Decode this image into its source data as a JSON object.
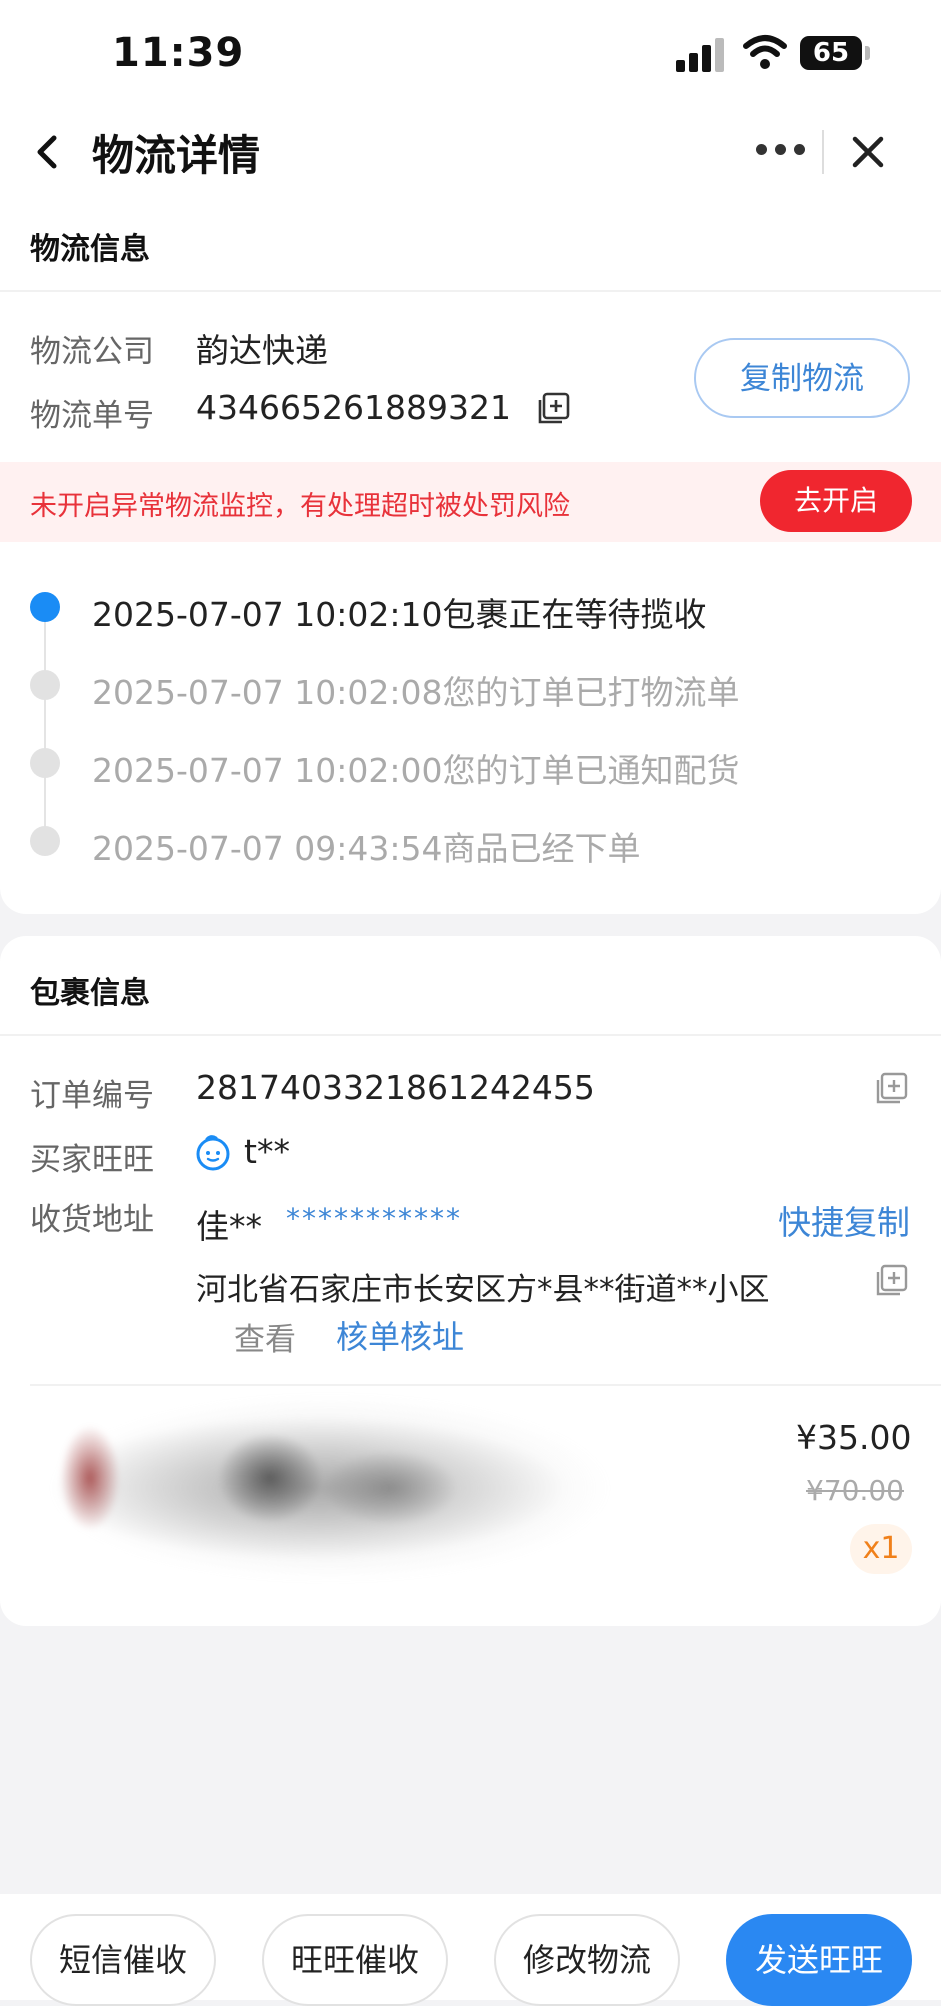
{
  "status_bar": {
    "time": "11:39",
    "battery": "65"
  },
  "nav": {
    "title": "物流详情"
  },
  "logistics": {
    "section_title": "物流信息",
    "company_label": "物流公司",
    "company_value": "韵达快递",
    "tracking_label": "物流单号",
    "tracking_value": "434665261889321",
    "copy_button": "复制物流",
    "alert_text": "未开启异常物流监控，有处理超时被处罚风险",
    "alert_button": "去开启",
    "timeline": [
      {
        "text": "2025-07-07 10:02:10包裹正在等待揽收"
      },
      {
        "text": "2025-07-07 10:02:08您的订单已打物流单"
      },
      {
        "text": "2025-07-07 10:02:00您的订单已通知配货"
      },
      {
        "text": "2025-07-07 09:43:54商品已经下单"
      }
    ]
  },
  "package": {
    "section_title": "包裹信息",
    "order_label": "订单编号",
    "order_value": "2817403321861242455",
    "buyer_label": "买家旺旺",
    "buyer_value": "t**",
    "address_label": "收货地址",
    "recipient_name": "佳**",
    "recipient_phone": "***********",
    "quick_copy": "快捷复制",
    "address_value": "河北省石家庄市长安区方*县**街道**小区",
    "view_label": "查看",
    "verify_link": "核单核址",
    "product": {
      "price": "¥35.00",
      "original_price": "¥70.00",
      "quantity": "x1"
    }
  },
  "bottom_actions": {
    "sms_remind": "短信催收",
    "wangwang_remind": "旺旺催收",
    "modify_logistics": "修改物流",
    "send_wangwang": "发送旺旺"
  },
  "colors": {
    "accent_blue": "#2a88f2",
    "alert_red": "#f0262f",
    "timeline_active": "#1a8cf5"
  }
}
